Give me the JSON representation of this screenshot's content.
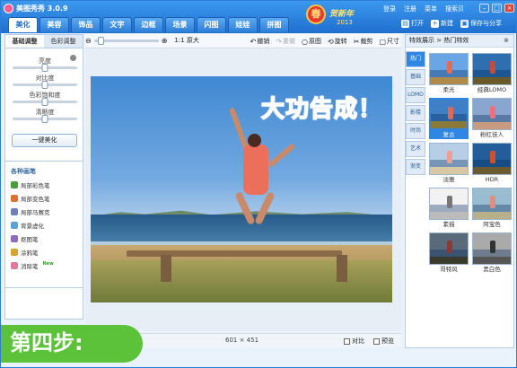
{
  "window": {
    "title": "美图秀秀 3.0.9"
  },
  "main_nav": [
    "美化",
    "美容",
    "饰品",
    "文字",
    "边框",
    "场景",
    "闪图",
    "娃娃",
    "拼图"
  ],
  "festive": {
    "badge": "春",
    "greeting": "贺新年",
    "year": "2013"
  },
  "top_menu": [
    "登录",
    "注册",
    "菜单",
    "搜索贝"
  ],
  "top_actions": [
    {
      "icon": "folder-icon",
      "label": "打开"
    },
    {
      "icon": "plus-icon",
      "label": "新建"
    },
    {
      "icon": "save-icon",
      "label": "保存与分享"
    }
  ],
  "left_panel": {
    "tabs": [
      "基础调整",
      "色彩调整"
    ],
    "sliders": [
      {
        "label": "亮度",
        "value": 0.5
      },
      {
        "label": "对比度",
        "value": 0.5
      },
      {
        "label": "色彩饱和度",
        "value": 0.5
      },
      {
        "label": "清晰度",
        "value": 0.5
      }
    ],
    "onekey_label": "一键美化",
    "tools_title": "各种画笔",
    "tools": [
      {
        "label": "局部彩色笔",
        "color": "#4a9d3a"
      },
      {
        "label": "局部变色笔",
        "color": "#d9752e"
      },
      {
        "label": "局部马赛克",
        "color": "#6c82b8"
      },
      {
        "label": "背景虚化",
        "color": "#5aa2d8"
      },
      {
        "label": "抠图笔",
        "color": "#8d6bc1"
      },
      {
        "label": "涂鸦笔",
        "color": "#d9a42e"
      },
      {
        "label": "消除笔",
        "color": "#e07aa0",
        "badge": "New"
      }
    ]
  },
  "toolbar": {
    "orig_label": "原大",
    "actions": [
      {
        "glyph": "↶",
        "label": "撤销",
        "enabled": true
      },
      {
        "glyph": "↷",
        "label": "重做",
        "enabled": false
      },
      {
        "glyph": "○",
        "label": "原图",
        "enabled": true
      },
      {
        "glyph": "⟲",
        "label": "旋转",
        "enabled": true
      },
      {
        "glyph": "✂",
        "label": "裁剪",
        "enabled": true
      },
      {
        "glyph": "▢",
        "label": "尺寸",
        "enabled": true
      }
    ]
  },
  "canvas": {
    "caption": "大功告成！"
  },
  "status": {
    "dims": "601 × 451",
    "compare": "对比",
    "preview": "预览"
  },
  "right_panel": {
    "header": "特效展示 > 热门特效",
    "categories": [
      "热门",
      "基础",
      "LOMO",
      "影楼",
      "时尚",
      "艺术",
      "渐变"
    ],
    "effects": [
      {
        "name": "柔光",
        "sky": "#6aa6e6",
        "ground": "#b08a4a",
        "fig": "#e86a55"
      },
      {
        "name": "经典LOMO",
        "sky": "#2f6fb0",
        "ground": "#6a5a2a",
        "fig": "#c84a3a"
      },
      {
        "name": "复古",
        "sky": "#3f7fc5",
        "ground": "#8a7a3a",
        "fig": "#e06a50"
      },
      {
        "name": "粉红佳人",
        "sky": "#8aa6d0",
        "ground": "#c89a80",
        "fig": "#ef6f7a"
      },
      {
        "name": "淡雅",
        "sky": "#b7cfe6",
        "ground": "#d8c8a6",
        "fig": "#f0a090"
      },
      {
        "name": "HDR",
        "sky": "#245e9a",
        "ground": "#6a5a30",
        "fig": "#d0502e"
      },
      {
        "name": "素描",
        "sky": "#f2f2f2",
        "ground": "#bbbbbb",
        "fig": "#777777"
      },
      {
        "name": "阿宝色",
        "sky": "#9abcd0",
        "ground": "#b8b08a",
        "fig": "#e08f7a"
      },
      {
        "name": "哥特风",
        "sky": "#5a6a7a",
        "ground": "#3a3a2a",
        "fig": "#8a3a30"
      },
      {
        "name": "黑白色",
        "sky": "#aaaaaa",
        "ground": "#555555",
        "fig": "#333333"
      }
    ]
  },
  "step_banner": "第四步:"
}
